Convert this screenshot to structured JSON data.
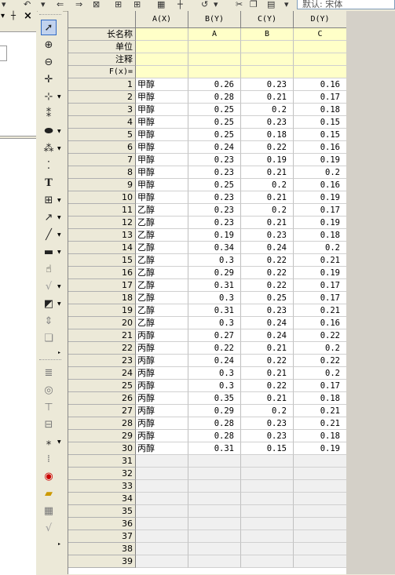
{
  "toolbar": {
    "font_combo": "默认: 宋体",
    "icons": [
      "dropdown-icon",
      "undo-icon",
      "redo-icon",
      "arrow-left-icon",
      "arrow-right-icon",
      "new-icon",
      "add-icon",
      "table-icon",
      "pin-icon",
      "undo-curve-icon",
      "cut-icon",
      "copy-icon",
      "paste-icon",
      "font-icon"
    ]
  },
  "explorer": {
    "pin_glyph": "┼",
    "close_glyph": "×",
    "dropdown_glyph": "▾"
  },
  "tools": [
    "pointer-icon",
    "zoom-in-icon",
    "zoom-out-icon",
    "crosshair-icon",
    "screen-reader-icon",
    "data-reader-icon",
    "draw-data-icon",
    "mask-icon",
    "region-select-icon",
    "text-icon",
    "arrange-icon",
    "arrow-tool-icon",
    "line-tool-icon",
    "rectangle-tool-icon",
    "hand-icon",
    "formula-icon",
    "add-graph-icon",
    "pan-icon",
    "layer-icon",
    "rows-icon",
    "target-icon",
    "align-icon",
    "column-icon",
    "formula2-icon",
    "grid-icon",
    "user-icon",
    "folder-icon",
    "table2-icon",
    "sqrt-icon"
  ],
  "columns": [
    {
      "header": "A(X)",
      "short": "",
      "units": "",
      "comment": "",
      "fx": ""
    },
    {
      "header": "B(Y)",
      "short": "A",
      "units": "",
      "comment": "",
      "fx": ""
    },
    {
      "header": "C(Y)",
      "short": "B",
      "units": "",
      "comment": "",
      "fx": ""
    },
    {
      "header": "D(Y)",
      "short": "C",
      "units": "",
      "comment": "",
      "fx": ""
    }
  ],
  "meta_rows": [
    "长名称",
    "单位",
    "注释",
    "F(x)="
  ],
  "rows": [
    [
      "1",
      "甲醇",
      "0.26",
      "0.23",
      "0.16"
    ],
    [
      "2",
      "甲醇",
      "0.28",
      "0.21",
      "0.17"
    ],
    [
      "3",
      "甲醇",
      "0.25",
      "0.2",
      "0.18"
    ],
    [
      "4",
      "甲醇",
      "0.25",
      "0.23",
      "0.15"
    ],
    [
      "5",
      "甲醇",
      "0.25",
      "0.18",
      "0.15"
    ],
    [
      "6",
      "甲醇",
      "0.24",
      "0.22",
      "0.16"
    ],
    [
      "7",
      "甲醇",
      "0.23",
      "0.19",
      "0.19"
    ],
    [
      "8",
      "甲醇",
      "0.23",
      "0.21",
      "0.2"
    ],
    [
      "9",
      "甲醇",
      "0.25",
      "0.2",
      "0.16"
    ],
    [
      "10",
      "甲醇",
      "0.23",
      "0.21",
      "0.19"
    ],
    [
      "11",
      "乙醇",
      "0.23",
      "0.2",
      "0.17"
    ],
    [
      "12",
      "乙醇",
      "0.23",
      "0.21",
      "0.19"
    ],
    [
      "13",
      "乙醇",
      "0.19",
      "0.23",
      "0.18"
    ],
    [
      "14",
      "乙醇",
      "0.34",
      "0.24",
      "0.2"
    ],
    [
      "15",
      "乙醇",
      "0.3",
      "0.22",
      "0.21"
    ],
    [
      "16",
      "乙醇",
      "0.29",
      "0.22",
      "0.19"
    ],
    [
      "17",
      "乙醇",
      "0.31",
      "0.22",
      "0.17"
    ],
    [
      "18",
      "乙醇",
      "0.3",
      "0.25",
      "0.17"
    ],
    [
      "19",
      "乙醇",
      "0.31",
      "0.23",
      "0.21"
    ],
    [
      "20",
      "乙醇",
      "0.3",
      "0.24",
      "0.16"
    ],
    [
      "21",
      "丙醇",
      "0.27",
      "0.24",
      "0.22"
    ],
    [
      "22",
      "丙醇",
      "0.22",
      "0.21",
      "0.2"
    ],
    [
      "23",
      "丙醇",
      "0.24",
      "0.22",
      "0.22"
    ],
    [
      "24",
      "丙醇",
      "0.3",
      "0.21",
      "0.2"
    ],
    [
      "25",
      "丙醇",
      "0.3",
      "0.22",
      "0.17"
    ],
    [
      "26",
      "丙醇",
      "0.35",
      "0.21",
      "0.18"
    ],
    [
      "27",
      "丙醇",
      "0.29",
      "0.2",
      "0.21"
    ],
    [
      "28",
      "丙醇",
      "0.28",
      "0.23",
      "0.21"
    ],
    [
      "29",
      "丙醇",
      "0.28",
      "0.23",
      "0.18"
    ],
    [
      "30",
      "丙醇",
      "0.31",
      "0.15",
      "0.19"
    ],
    [
      "31",
      "",
      "",
      "",
      ""
    ],
    [
      "32",
      "",
      "",
      "",
      ""
    ],
    [
      "33",
      "",
      "",
      "",
      ""
    ],
    [
      "34",
      "",
      "",
      "",
      ""
    ],
    [
      "35",
      "",
      "",
      "",
      ""
    ],
    [
      "36",
      "",
      "",
      "",
      ""
    ],
    [
      "37",
      "",
      "",
      "",
      ""
    ],
    [
      "38",
      "",
      "",
      "",
      ""
    ],
    [
      "39",
      "",
      "",
      "",
      ""
    ]
  ]
}
